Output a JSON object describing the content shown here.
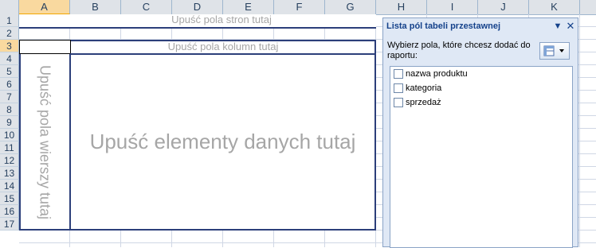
{
  "columns": [
    "A",
    "B",
    "C",
    "D",
    "E",
    "F",
    "G",
    "H",
    "I",
    "J",
    "K"
  ],
  "rows": [
    "1",
    "2",
    "3",
    "4",
    "5",
    "6",
    "7",
    "8",
    "9",
    "10",
    "11",
    "12",
    "13",
    "14",
    "15",
    "16",
    "17"
  ],
  "selected_column": "A",
  "selected_row": "3",
  "pivot": {
    "page_fields_drop": "Upuść pola stron tutaj",
    "column_fields_drop": "Upuść pola kolumn tutaj",
    "row_fields_drop": "Upuść pola wierszy tutaj",
    "data_items_drop": "Upuść elementy danych tutaj"
  },
  "field_list_panel": {
    "title": "Lista pól tabeli przestawnej",
    "instructions": "Wybierz pola, które chcesz dodać do raportu:",
    "fields": [
      {
        "label": "nazwa produktu",
        "checked": false
      },
      {
        "label": "kategoria",
        "checked": false
      },
      {
        "label": "sprzedaż",
        "checked": false
      }
    ]
  },
  "colors": {
    "pivot_border": "#2c3f7a",
    "drop_text": "#a6a6a6",
    "selection": "#f9d99f"
  }
}
